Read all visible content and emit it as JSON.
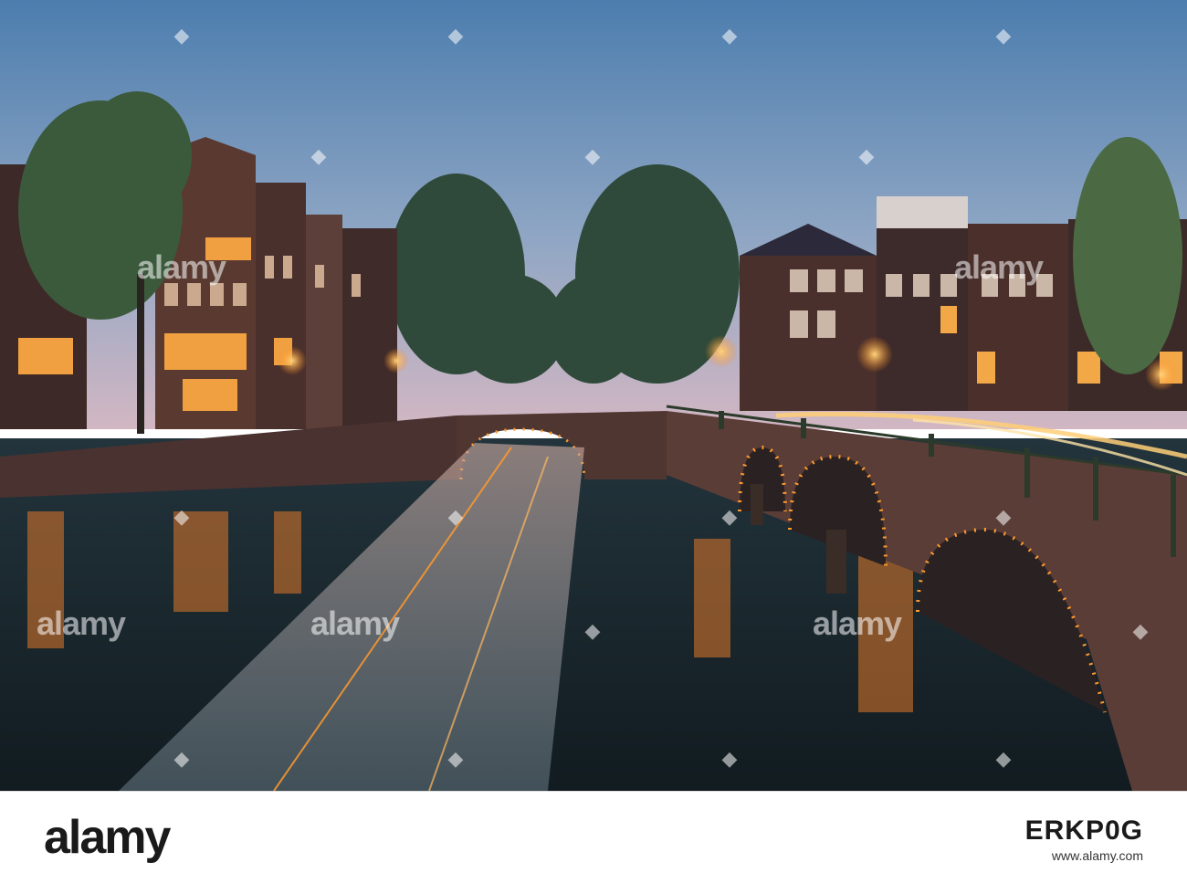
{
  "image": {
    "scene": "Amsterdam canal at dusk with illuminated arched bridges and boat light trails",
    "colors": {
      "sky_top": "#4f7fb0",
      "sky_bottom": "#c9b3c4",
      "water": "#1b2b33",
      "bridge_lights": "#ff9a2e",
      "building": "#4a2f2a"
    }
  },
  "watermark": {
    "text": "alamy",
    "diamond_icon": "diamond-icon"
  },
  "footer": {
    "logo": "alamy",
    "image_code": "ERKP0G",
    "url": "www.alamy.com"
  }
}
